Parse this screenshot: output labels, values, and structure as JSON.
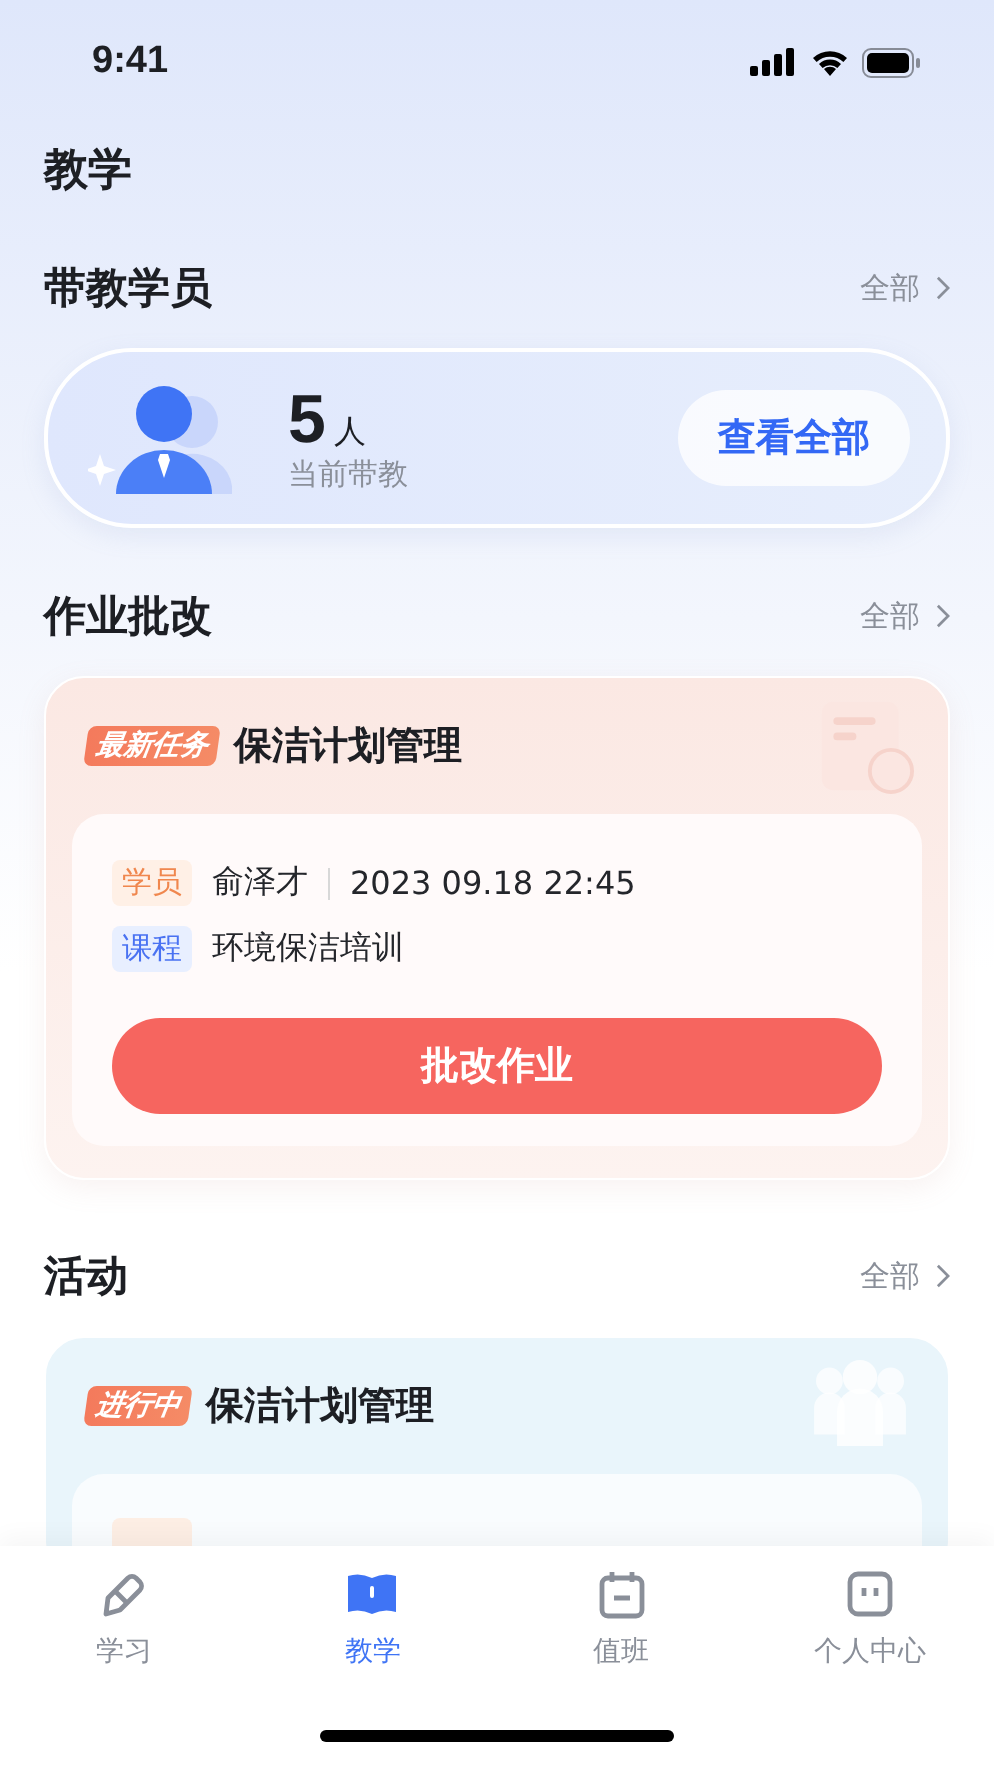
{
  "status_bar": {
    "time": "9:41"
  },
  "page_title": "教学",
  "mentees": {
    "title": "带教学员",
    "more": "全部",
    "count": "5",
    "unit": "人",
    "caption": "当前带教",
    "button": "查看全部"
  },
  "homework": {
    "title": "作业批改",
    "more": "全部",
    "tag": "最新任务",
    "task": "保洁计划管理",
    "fields": [
      {
        "kind": "student",
        "label": "学员",
        "value": "俞泽才",
        "time": "2023 09.18 22:45"
      },
      {
        "kind": "course",
        "label": "课程",
        "value": "环境保洁培训"
      }
    ],
    "button": "批改作业"
  },
  "activity": {
    "title": "活动",
    "more": "全部",
    "tag": "进行中",
    "task": "保洁计划管理"
  },
  "tabs": [
    {
      "kind": "study",
      "label": "学习",
      "selected": false
    },
    {
      "kind": "teach",
      "label": "教学",
      "selected": true
    },
    {
      "kind": "duty",
      "label": "值班",
      "selected": false
    },
    {
      "kind": "profile",
      "label": "个人中心",
      "selected": false
    }
  ]
}
